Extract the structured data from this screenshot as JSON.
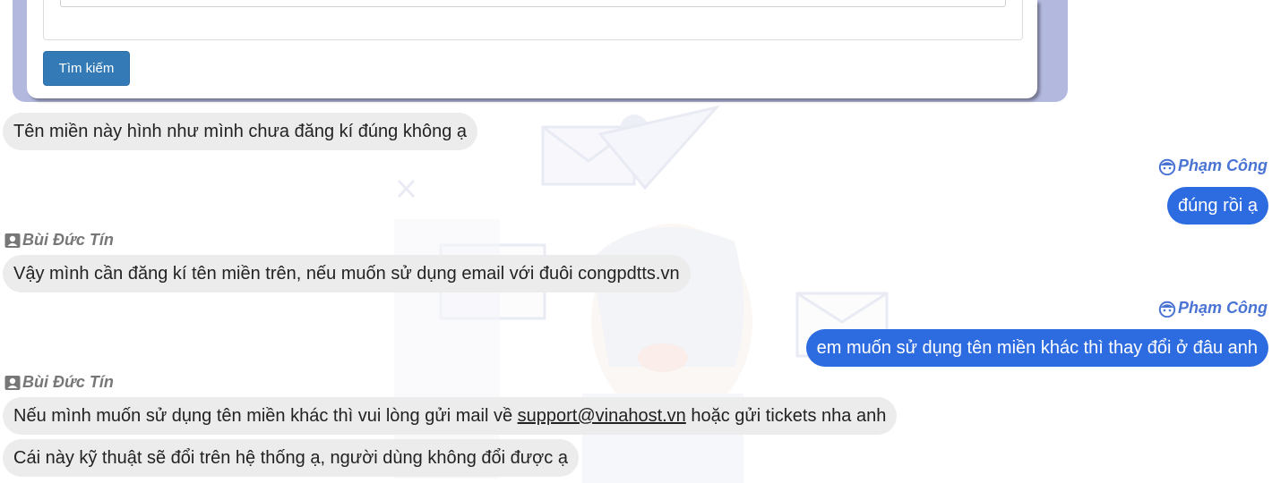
{
  "search": {
    "button_label": "Tìm kiếm"
  },
  "colors": {
    "accent": "#337ab7",
    "outgoing": "#2d6be0",
    "incoming": "#ececec",
    "agent_name": "#777777",
    "user_name": "#4a74d4"
  },
  "messages": [
    {
      "direction": "in",
      "text": "Tên miền này hình như mình chưa đăng kí đúng không ạ"
    },
    {
      "direction": "out",
      "sender": "Phạm Công",
      "sender_icon": "user-face-icon",
      "text": "đúng rồi ạ"
    },
    {
      "direction": "in",
      "sender": "Bùi Đức Tín",
      "sender_icon": "contact-card-icon",
      "text": "Vậy mình cần đăng kí tên miền trên, nếu muốn sử dụng email với đuôi congpdtts.vn"
    },
    {
      "direction": "out",
      "sender": "Phạm Công",
      "sender_icon": "user-face-icon",
      "text": "em muốn sử dụng tên miền khác thì thay đổi ở đâu anh"
    },
    {
      "direction": "in",
      "sender": "Bùi Đức Tín",
      "sender_icon": "contact-card-icon",
      "text_before": "Nếu mình muốn sử dụng tên miền khác thì vui lòng gửi mail về ",
      "link": "support@vinahost.vn",
      "text_after": " hoặc gửi tickets nha anh"
    },
    {
      "direction": "in",
      "text": "Cái này kỹ thuật sẽ đổi trên hệ thống ạ, người dùng không đổi được ạ"
    }
  ]
}
